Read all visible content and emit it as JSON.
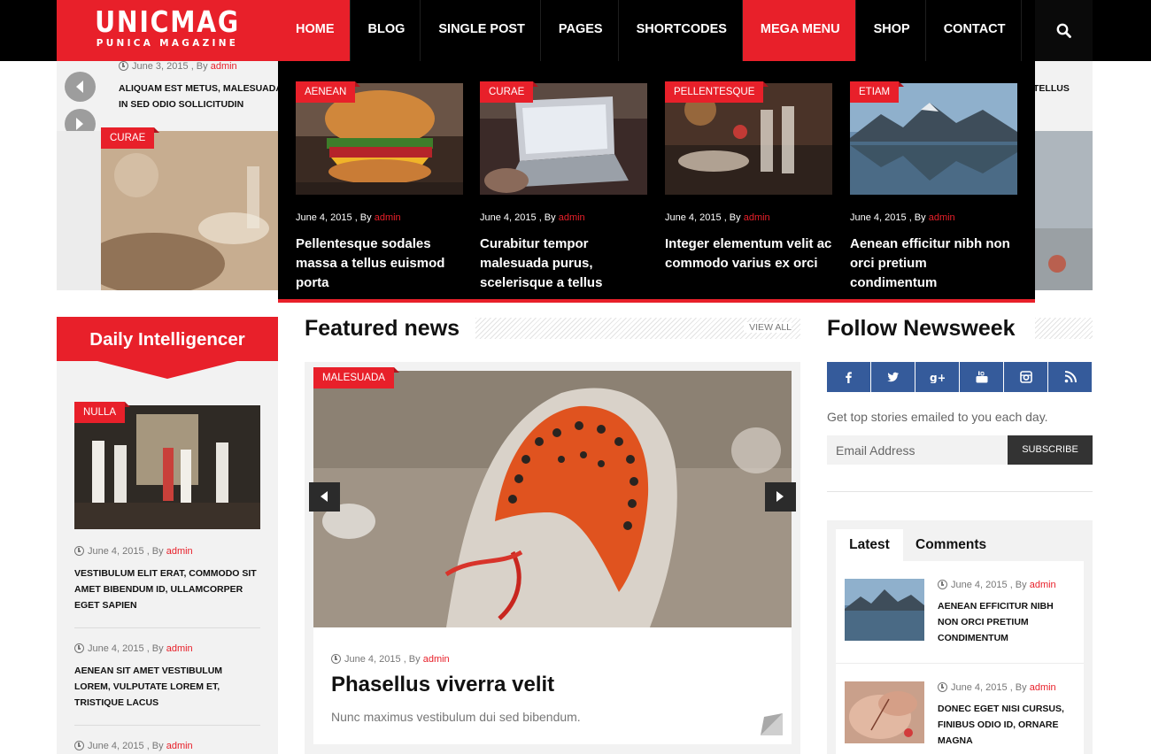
{
  "logo": {
    "title": "UNICMAG",
    "tagline": "PUNICA MAGAZINE"
  },
  "nav": {
    "items": [
      "HOME",
      "BLOG",
      "SINGLE POST",
      "PAGES",
      "SHORTCODES",
      "MEGA MENU",
      "SHOP",
      "CONTACT"
    ],
    "active": "HOME",
    "open": "MEGA MENU"
  },
  "colors": {
    "accent": "#e8202a",
    "topbar": "#000000",
    "social": "#355b9b",
    "panel": "#f2f2f2"
  },
  "icons": {
    "search": "search-icon",
    "prev": "arrow-left-icon",
    "next": "arrow-right-icon",
    "clock": "clock-icon"
  },
  "ticker": {
    "date": "June 3, 2015",
    "by": ", By",
    "author": "admin",
    "title": "ALIQUAM EST METUS, MALESUADA",
    "title_line2": "IN SED ODIO SOLLICITUDIN",
    "right_fragment": "TELLUS"
  },
  "slider": {
    "left_tag": "CURAE"
  },
  "mega": {
    "by": ", By",
    "items": [
      {
        "tag": "AENEAN",
        "date": "June 4, 2015",
        "author": "admin",
        "title": "Pellentesque sodales massa a tellus euismod porta"
      },
      {
        "tag": "CURAE",
        "date": "June 4, 2015",
        "author": "admin",
        "title": "Curabitur tempor malesuada purus, scelerisque a tellus"
      },
      {
        "tag": "PELLENTESQUE",
        "date": "June 4, 2015",
        "author": "admin",
        "title": "Integer elementum velit ac commodo varius ex orci"
      },
      {
        "tag": "ETIAM",
        "date": "June 4, 2015",
        "author": "admin",
        "title": "Aenean efficitur nibh non orci pretium condimentum"
      }
    ]
  },
  "daily": {
    "heading": "Daily Intelligencer",
    "tag": "NULLA",
    "by": ", By",
    "posts": [
      {
        "date": "June 4, 2015",
        "author": "admin",
        "title": "VESTIBULUM ELIT ERAT, COMMODO SIT AMET BIBENDUM ID, ULLAMCORPER EGET SAPIEN"
      },
      {
        "date": "June 4, 2015",
        "author": "admin",
        "title": "AENEAN SIT AMET VESTIBULUM LOREM, VULPUTATE LOREM ET, TRISTIQUE LACUS"
      },
      {
        "date": "June 4, 2015",
        "author": "admin",
        "title": ""
      }
    ]
  },
  "featured": {
    "heading": "Featured news",
    "view_all": "VIEW ALL",
    "tag": "MALESUADA",
    "date": "June 4, 2015",
    "by": ", By",
    "author": "admin",
    "title": "Phasellus viverra velit",
    "excerpt": "Nunc maximus vestibulum dui sed bibendum."
  },
  "follow": {
    "heading": "Follow Newsweek",
    "socials": [
      "facebook-icon",
      "twitter-icon",
      "google-plus-icon",
      "youtube-icon",
      "instagram-icon",
      "rss-icon"
    ],
    "newsletter_text": "Get top stories emailed to you each day.",
    "email_placeholder": "Email Address",
    "subscribe_label": "SUBSCRIBE"
  },
  "tabs": {
    "labels": [
      "Latest",
      "Comments"
    ],
    "active": "Latest",
    "by": ", By",
    "items": [
      {
        "date": "June 4, 2015",
        "author": "admin",
        "title": "AENEAN EFFICITUR NIBH NON ORCI PRETIUM CONDIMENTUM"
      },
      {
        "date": "June 4, 2015",
        "author": "admin",
        "title": "DONEC EGET NISI CURSUS, FINIBUS ODIO ID, ORNARE MAGNA"
      }
    ]
  }
}
